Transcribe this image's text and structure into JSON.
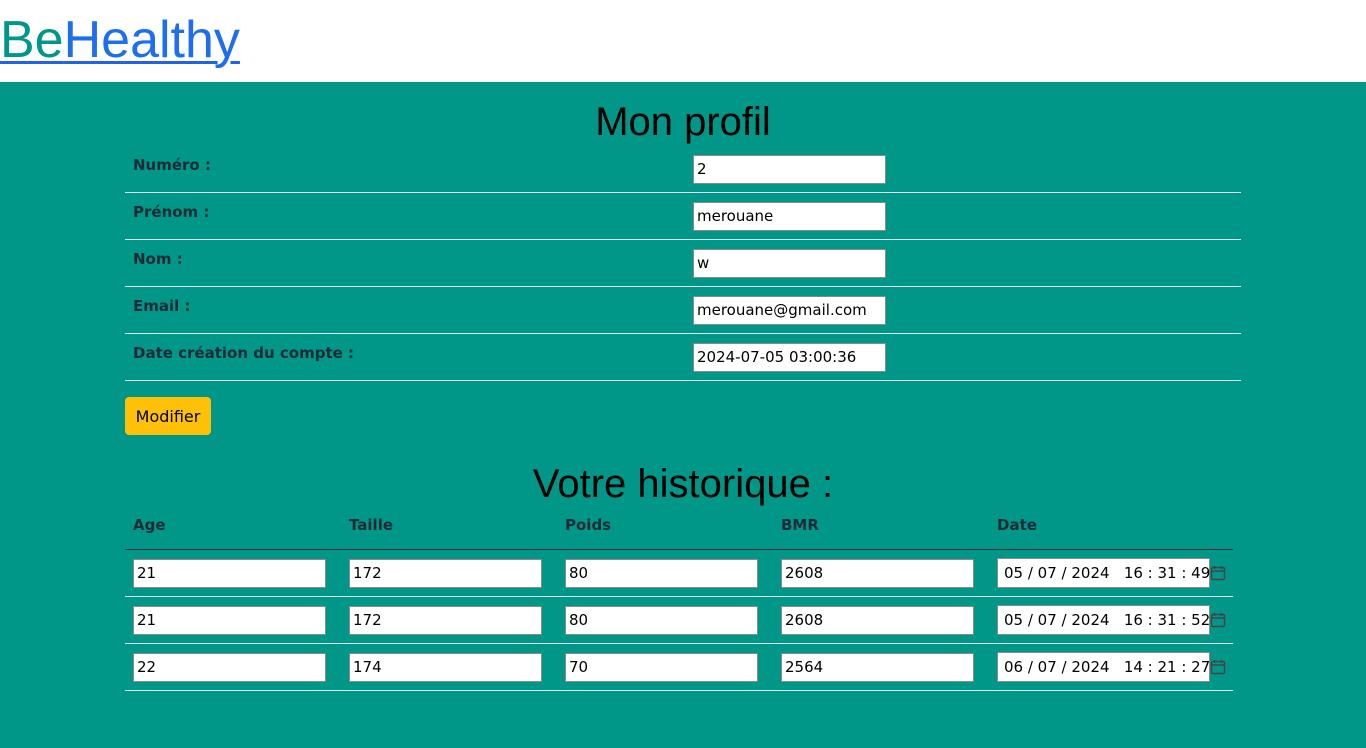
{
  "header": {
    "logo_part1": "Be",
    "logo_part2": "Healthy"
  },
  "profile": {
    "title": "Mon profil",
    "fields": [
      {
        "label": "Numéro :",
        "value": "2"
      },
      {
        "label": "Prénom :",
        "value": "merouane"
      },
      {
        "label": "Nom :",
        "value": "w"
      },
      {
        "label": "Email :",
        "value": "merouane@gmail.com"
      },
      {
        "label": "Date création du compte :",
        "value": "2024-07-05 03:00:36"
      }
    ],
    "modify_label": "Modifier"
  },
  "history": {
    "title": "Votre historique :",
    "columns": [
      "Age",
      "Taille",
      "Poids",
      "BMR",
      "Date"
    ],
    "rows": [
      {
        "age": "21",
        "taille": "172",
        "poids": "80",
        "bmr": "2608",
        "date": "05 / 07 / 2024   16 : 31 : 49"
      },
      {
        "age": "21",
        "taille": "172",
        "poids": "80",
        "bmr": "2608",
        "date": "05 / 07 / 2024   16 : 31 : 52"
      },
      {
        "age": "22",
        "taille": "174",
        "poids": "70",
        "bmr": "2564",
        "date": "06 / 07 / 2024   14 : 21 : 27"
      }
    ]
  },
  "colors": {
    "background": "#009688",
    "button": "#ffc107",
    "logo_green": "#00968a",
    "logo_blue": "#1e6ef0"
  },
  "icons": {
    "date_picker": "calendar-icon"
  }
}
